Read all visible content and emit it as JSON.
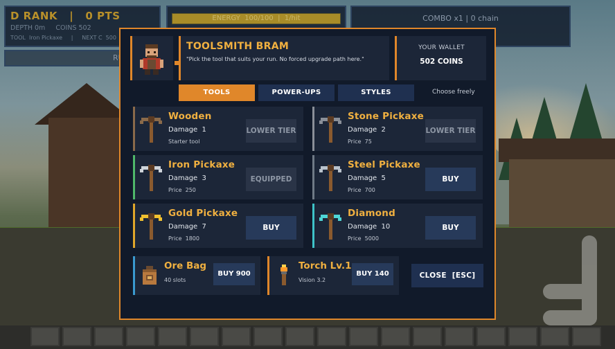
{
  "hud": {
    "rank": "D RANK",
    "points": "0 PTS",
    "depth": "DEPTH 0m",
    "coins": "COINS 502",
    "tool_line": "TOOL  Iron Pickaxe     |     NEXT C  500",
    "energy_text": "ENERGY  100/100  |  1/hit",
    "energy_level": 1.0,
    "combo": "COMBO x1  |  0 chain",
    "strip_text": "RU"
  },
  "shop": {
    "keeper_name": "TOOLSMITH BRAM",
    "keeper_quote": "\"Pick the tool that suits your run. No forced upgrade path here.\"",
    "wallet_label": "YOUR WALLET",
    "wallet_value": "502 COINS",
    "tabs": [
      "TOOLS",
      "POWER-UPS",
      "STYLES"
    ],
    "active_tab": "TOOLS",
    "tab_hint": "Choose freely",
    "tools": [
      {
        "name": "Wooden",
        "damage": "Damage  1",
        "info": "Starter tool",
        "button": "LOWER TIER",
        "state": "disabled",
        "accent": "#8a6a4a"
      },
      {
        "name": "Stone Pickaxe",
        "damage": "Damage  2",
        "info": "Price  75",
        "button": "LOWER TIER",
        "state": "disabled",
        "accent": "#8a8f98"
      },
      {
        "name": "Iron Pickaxe",
        "damage": "Damage  3",
        "info": "Price  250",
        "button": "EQUIPPED",
        "state": "equipped",
        "accent": "#4fb86a"
      },
      {
        "name": "Steel Pickaxe",
        "damage": "Damage  5",
        "info": "Price  700",
        "button": "BUY",
        "state": "buy",
        "accent": "#6f7a86"
      },
      {
        "name": "Gold Pickaxe",
        "damage": "Damage  7",
        "info": "Price  1800",
        "button": "BUY",
        "state": "buy",
        "accent": "#e0a62a"
      },
      {
        "name": "Diamond",
        "damage": "Damage  10",
        "info": "Price  5000",
        "button": "BUY",
        "state": "buy",
        "accent": "#3ec3c8"
      }
    ],
    "utilities": [
      {
        "name": "Ore Bag",
        "info": "40 slots",
        "button": "BUY 900"
      },
      {
        "name": "Torch Lv.1",
        "info": "Vision 3.2",
        "button": "BUY 140"
      }
    ],
    "close_label": "CLOSE  [ESC]"
  },
  "icons": {
    "keeper": "blacksmith-avatar-icon",
    "pickaxe": "pickaxe-icon",
    "bag": "ore-bag-icon",
    "torch": "torch-icon"
  },
  "colors": {
    "accent_orange": "#e0872a",
    "title_gold": "#f0b040",
    "panel": "#1c2638",
    "modal_bg": "#111a2a"
  }
}
